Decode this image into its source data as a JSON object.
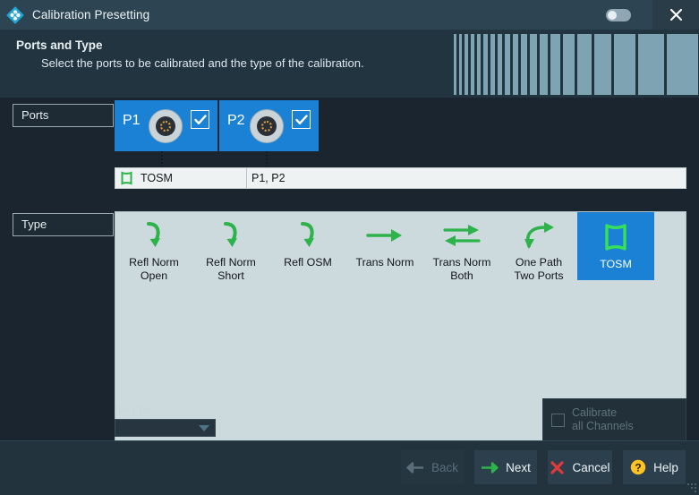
{
  "window": {
    "title": "Calibration Presetting",
    "logo_icon": "rohde-schwarz-logo",
    "toggle_icon": "toggle-switch",
    "close_icon": "close-icon"
  },
  "header": {
    "title": "Ports and Type",
    "subtitle": "Select the ports to be calibrated and the type of the calibration."
  },
  "ports_section": {
    "label": "Ports",
    "tiles": [
      {
        "name": "P1",
        "connector_icon": "coax-connector-icon",
        "checked": true
      },
      {
        "name": "P2",
        "connector_icon": "coax-connector-icon",
        "checked": true
      }
    ]
  },
  "summary": {
    "icon": "tosm-icon",
    "cal_type": "TOSM",
    "ports": "P1, P2"
  },
  "type_section": {
    "label": "Type",
    "items": [
      {
        "label": "Refl Norm\nOpen",
        "icon": "refl-arrow-icon",
        "selected": false
      },
      {
        "label": "Refl Norm\nShort",
        "icon": "refl-arrow-icon",
        "selected": false
      },
      {
        "label": "Refl OSM",
        "icon": "refl-arrow-icon",
        "selected": false
      },
      {
        "label": "Trans Norm",
        "icon": "trans-arrow-icon",
        "selected": false
      },
      {
        "label": "Trans Norm\nBoth",
        "icon": "trans-both-arrow-icon",
        "selected": false
      },
      {
        "label": "One Path\nTwo Ports",
        "icon": "one-path-arrow-icon",
        "selected": false
      },
      {
        "label": "TOSM",
        "icon": "tosm-icon",
        "selected": true
      }
    ]
  },
  "source": {
    "label": "Source",
    "value": "",
    "placeholder": ""
  },
  "calibrate_all": {
    "label": "Calibrate\nall Channels",
    "checked": false,
    "enabled": false
  },
  "footer": {
    "buttons": [
      {
        "label": "Back",
        "icon": "arrow-left-icon",
        "enabled": false
      },
      {
        "label": "Next",
        "icon": "arrow-right-icon",
        "enabled": true
      },
      {
        "label": "Cancel",
        "icon": "cross-icon",
        "enabled": true
      },
      {
        "label": "Help",
        "icon": "question-icon",
        "enabled": true
      }
    ]
  },
  "colors": {
    "accent_blue": "#1a81d4",
    "titlebar": "#2d4452",
    "header_band": "#22343f",
    "panel": "#ccd9dd",
    "green": "#2db34a",
    "red": "#e03a3a",
    "yellow": "#ffc324",
    "stripe": "#7ea4b4"
  }
}
